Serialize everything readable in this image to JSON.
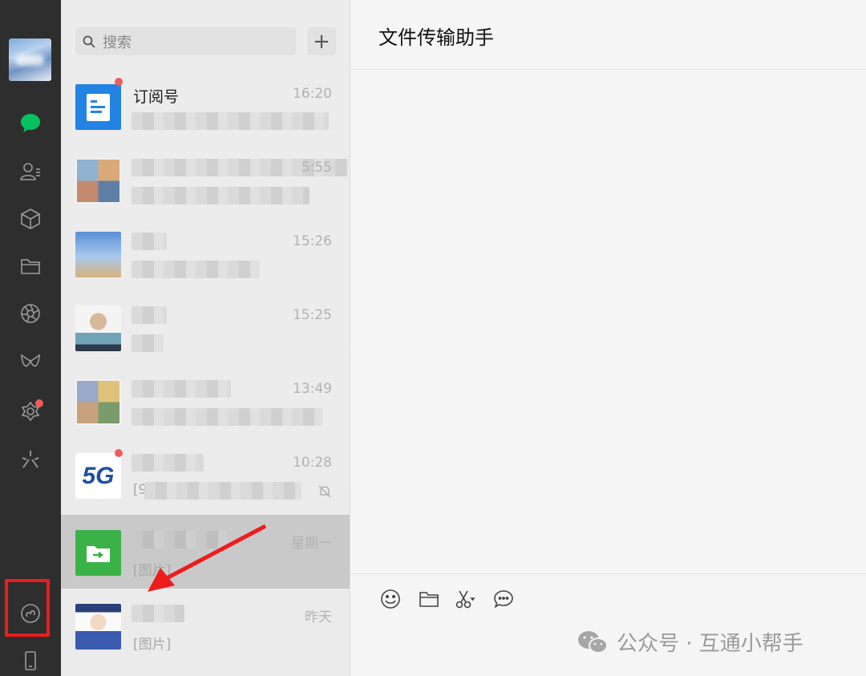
{
  "window": {
    "title": "文件传输助手"
  },
  "search": {
    "placeholder": "搜索",
    "add_label": "+"
  },
  "nav": {
    "items": [
      {
        "name": "chat-icon"
      },
      {
        "name": "contacts-icon"
      },
      {
        "name": "collections-icon"
      },
      {
        "name": "files-icon"
      },
      {
        "name": "moments-icon"
      },
      {
        "name": "channels-icon"
      },
      {
        "name": "search-discover-icon",
        "badge": true
      },
      {
        "name": "top-stories-icon"
      },
      {
        "name": "mini-program-icon"
      },
      {
        "name": "phone-icon"
      }
    ]
  },
  "chats": [
    {
      "name": "订阅号",
      "time": "16:20",
      "message": "",
      "badge": true,
      "avatar": "subscription-icon"
    },
    {
      "name": "",
      "time": "5:55",
      "message": "",
      "badge": false,
      "avatar": "group-collage"
    },
    {
      "name": "",
      "time": "15:26",
      "message": "",
      "badge": false,
      "avatar": "photo-sky"
    },
    {
      "name": "",
      "time": "15:25",
      "message": "",
      "badge": false,
      "avatar": "cartoon-girl"
    },
    {
      "name": "",
      "time": "13:49",
      "message": "",
      "badge": false,
      "avatar": "group-collage-2"
    },
    {
      "name": "",
      "time": "10:28",
      "message": "[9",
      "badge": true,
      "avatar": "5g-logo",
      "muted": true
    },
    {
      "name": "",
      "time": "星期一",
      "message": "[图片]",
      "badge": false,
      "avatar": "file-transfer",
      "selected": true
    },
    {
      "name": "",
      "time": "昨天",
      "message": "[图片]",
      "badge": false,
      "avatar": "cartoon-boy"
    }
  ],
  "avatar_5g_text": "5G",
  "toolbar": {
    "emoji": "emoji-icon",
    "folder": "folder-icon",
    "screenshot": "scissors-icon",
    "chat_history": "chat-bubble-icon"
  },
  "watermark": {
    "text": "公众号 · 互通小帮手"
  },
  "colors": {
    "nav_bg": "#2e2e2e",
    "active_green": "#07c160",
    "badge_red": "#f15b5b",
    "highlight_red": "#ee1c1c"
  }
}
